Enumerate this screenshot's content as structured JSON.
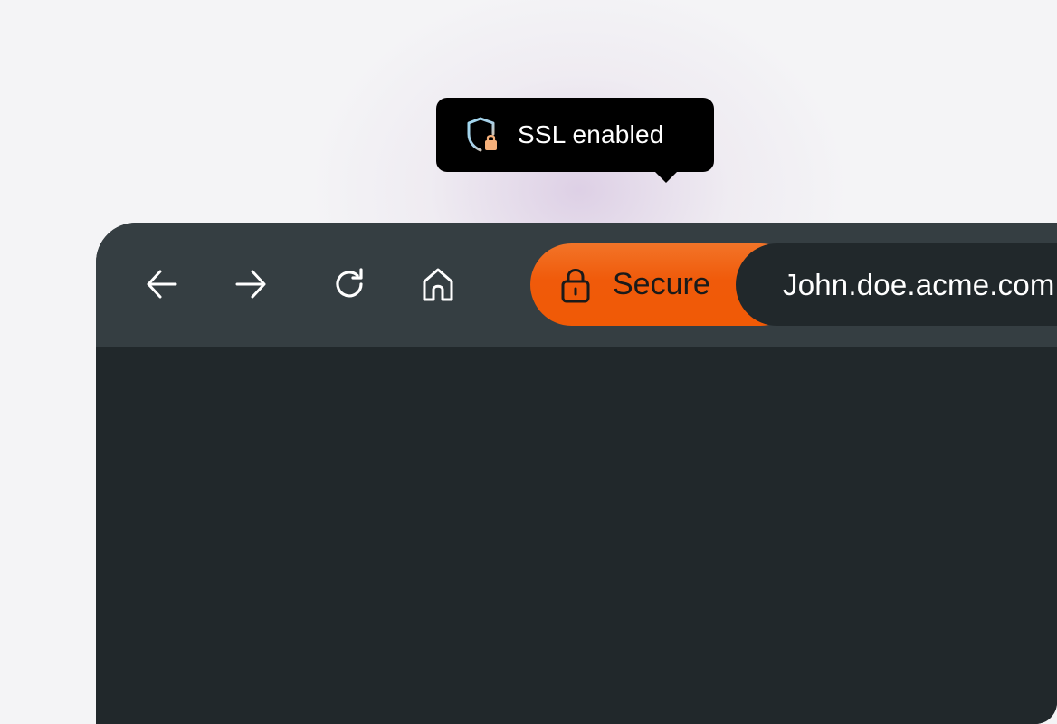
{
  "tooltip": {
    "icon": "shield-lock-icon",
    "text": "SSL enabled"
  },
  "toolbar": {
    "buttons": [
      {
        "icon": "arrow-left-icon",
        "action": "back"
      },
      {
        "icon": "arrow-right-icon",
        "action": "forward"
      },
      {
        "icon": "reload-icon",
        "action": "reload"
      },
      {
        "icon": "home-icon",
        "action": "home"
      }
    ],
    "security": {
      "icon": "lock-icon",
      "label": "Secure",
      "color": "#f05a0a"
    },
    "address": {
      "value": "John.doe.acme.com"
    }
  },
  "colors": {
    "toolbar_bg": "#353e42",
    "content_bg": "#21282b",
    "tooltip_bg": "#000000",
    "accent": "#f05a0a"
  }
}
